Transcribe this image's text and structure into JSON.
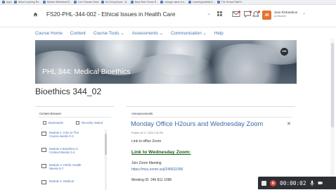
{
  "bookmarks": [
    "Apps",
    "About Learning Ro...",
    "Bobbie Whitehead R...",
    "Live Thomas Video",
    "It's Going Down - B...",
    "Back Rain Check R...",
    "change name of a...",
    "Learning Activity A...",
    "The School Staff S..."
  ],
  "header": {
    "course_title": "FS20-PHL-344-002 - Ethical Issues in Health Care",
    "user_initials": "JR",
    "user_name": "Jess Richardson",
    "user_role": "as Student"
  },
  "nav": {
    "items": [
      "Course Home",
      "Content",
      "Course Tools ⌄",
      "Assessments ⌄",
      "Communication ⌄",
      "Help"
    ]
  },
  "hero": {
    "title": "PHL 344: Medical Bioethics",
    "more_label": "•••"
  },
  "page": {
    "heading": "Bioethics 344_02"
  },
  "content_browser": {
    "title": "Content Browser",
    "bookmarks_label": "Bookmarks",
    "recently_visited_label": "Recently Visited",
    "modules": [
      {
        "line1": "Module 1: Intro to The",
        "line2": "Course weeks 0-2"
      },
      {
        "line1": "Module 2 Bioethics in",
        "line2": "Context Weeks 3-4"
      },
      {
        "line1": "Module 3: Public Health",
        "line2": "Weeks 5-7"
      },
      {
        "line1": "Module 4: Medical",
        "line2": ""
      }
    ]
  },
  "announcements": {
    "label": "Announcements",
    "title": "Monday Office H2ours and Wednesday Zoom",
    "date": "Posted Jul 17, 2020 1:52 PM",
    "text1": "Link to office Zoom",
    "link": "Link to Wednesday Zoom:",
    "zoom_label": "Join Zoom Meeting",
    "zoom_url": "https://msu.zoom.us/j/246811096",
    "meeting_id": "Meeting ID: 246 811 1096"
  },
  "recorder": {
    "time": "00:00:02"
  }
}
